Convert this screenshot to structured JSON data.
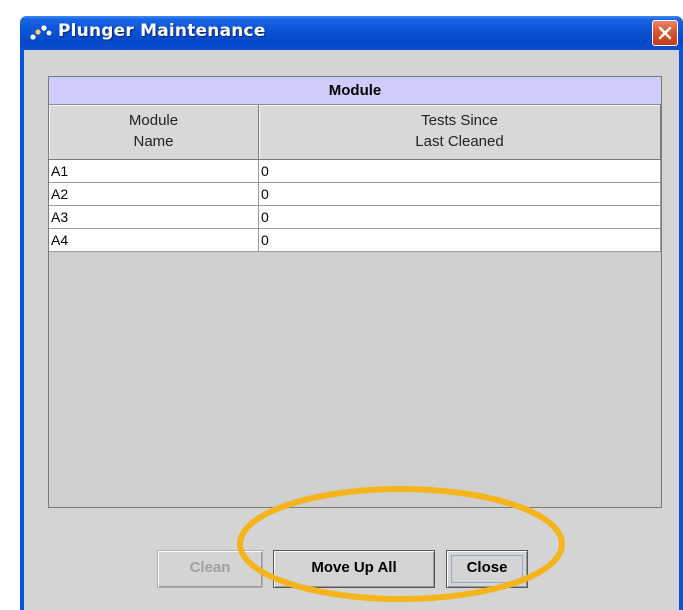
{
  "window": {
    "title": "Plunger Maintenance",
    "icon": "app-dots-icon",
    "close_icon": "close-x-icon"
  },
  "table": {
    "title": "Module",
    "headers": [
      {
        "lines": [
          "Module",
          "Name"
        ]
      },
      {
        "lines": [
          "Tests Since",
          "Last Cleaned"
        ]
      }
    ],
    "rows": [
      {
        "name": "A1",
        "tests": "0"
      },
      {
        "name": "A2",
        "tests": "0"
      },
      {
        "name": "A3",
        "tests": "0"
      },
      {
        "name": "A4",
        "tests": "0"
      }
    ]
  },
  "buttons": {
    "clean": "Clean",
    "move_up_all": "Move Up All",
    "close": "Close"
  },
  "colors": {
    "titlebar": "#0a52d6",
    "table_title_bg": "#cdccfb",
    "highlight_ring": "#f5b51a",
    "client_bg": "#d4d4d4"
  }
}
